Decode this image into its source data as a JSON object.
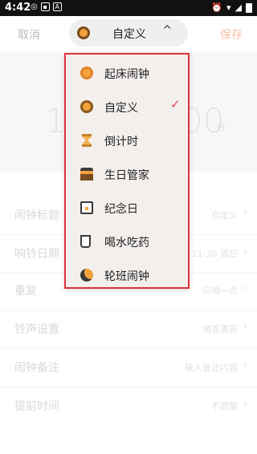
{
  "status_bar": {
    "time": "4:42"
  },
  "header": {
    "cancel": "取消",
    "save": "保存",
    "type_selected": "自定义",
    "caret": "^"
  },
  "background": {
    "time_hour": "1",
    "time_minute": "00",
    "minute_unit": "分"
  },
  "settings_rows": [
    {
      "label": "闹钟标题",
      "value": "自定义"
    },
    {
      "label": "响铃日期",
      "value": "11-30 周日"
    },
    {
      "label": "重复",
      "value": "只响一次"
    },
    {
      "label": "铃声设置",
      "value": "滴答滴答"
    },
    {
      "label": "闹钟备注",
      "value": "输入备注内容"
    },
    {
      "label": "提前时间",
      "value": "不提醒"
    }
  ],
  "dropdown": {
    "items": [
      {
        "label": "起床闹钟",
        "icon": "alarm-clock-icon",
        "selected": false
      },
      {
        "label": "自定义",
        "icon": "gear-icon",
        "selected": true
      },
      {
        "label": "倒计时",
        "icon": "hourglass-icon",
        "selected": false
      },
      {
        "label": "生日管家",
        "icon": "cake-icon",
        "selected": false
      },
      {
        "label": "纪念日",
        "icon": "calendar-icon",
        "selected": false
      },
      {
        "label": "喝水吃药",
        "icon": "cup-icon",
        "selected": false
      },
      {
        "label": "轮班闹钟",
        "icon": "moon-icon",
        "selected": false
      }
    ],
    "check_mark": "✓",
    "highlight_color": "#e0333d"
  },
  "colors": {
    "accent": "#f3a23c",
    "save": "#f5c1a0"
  }
}
